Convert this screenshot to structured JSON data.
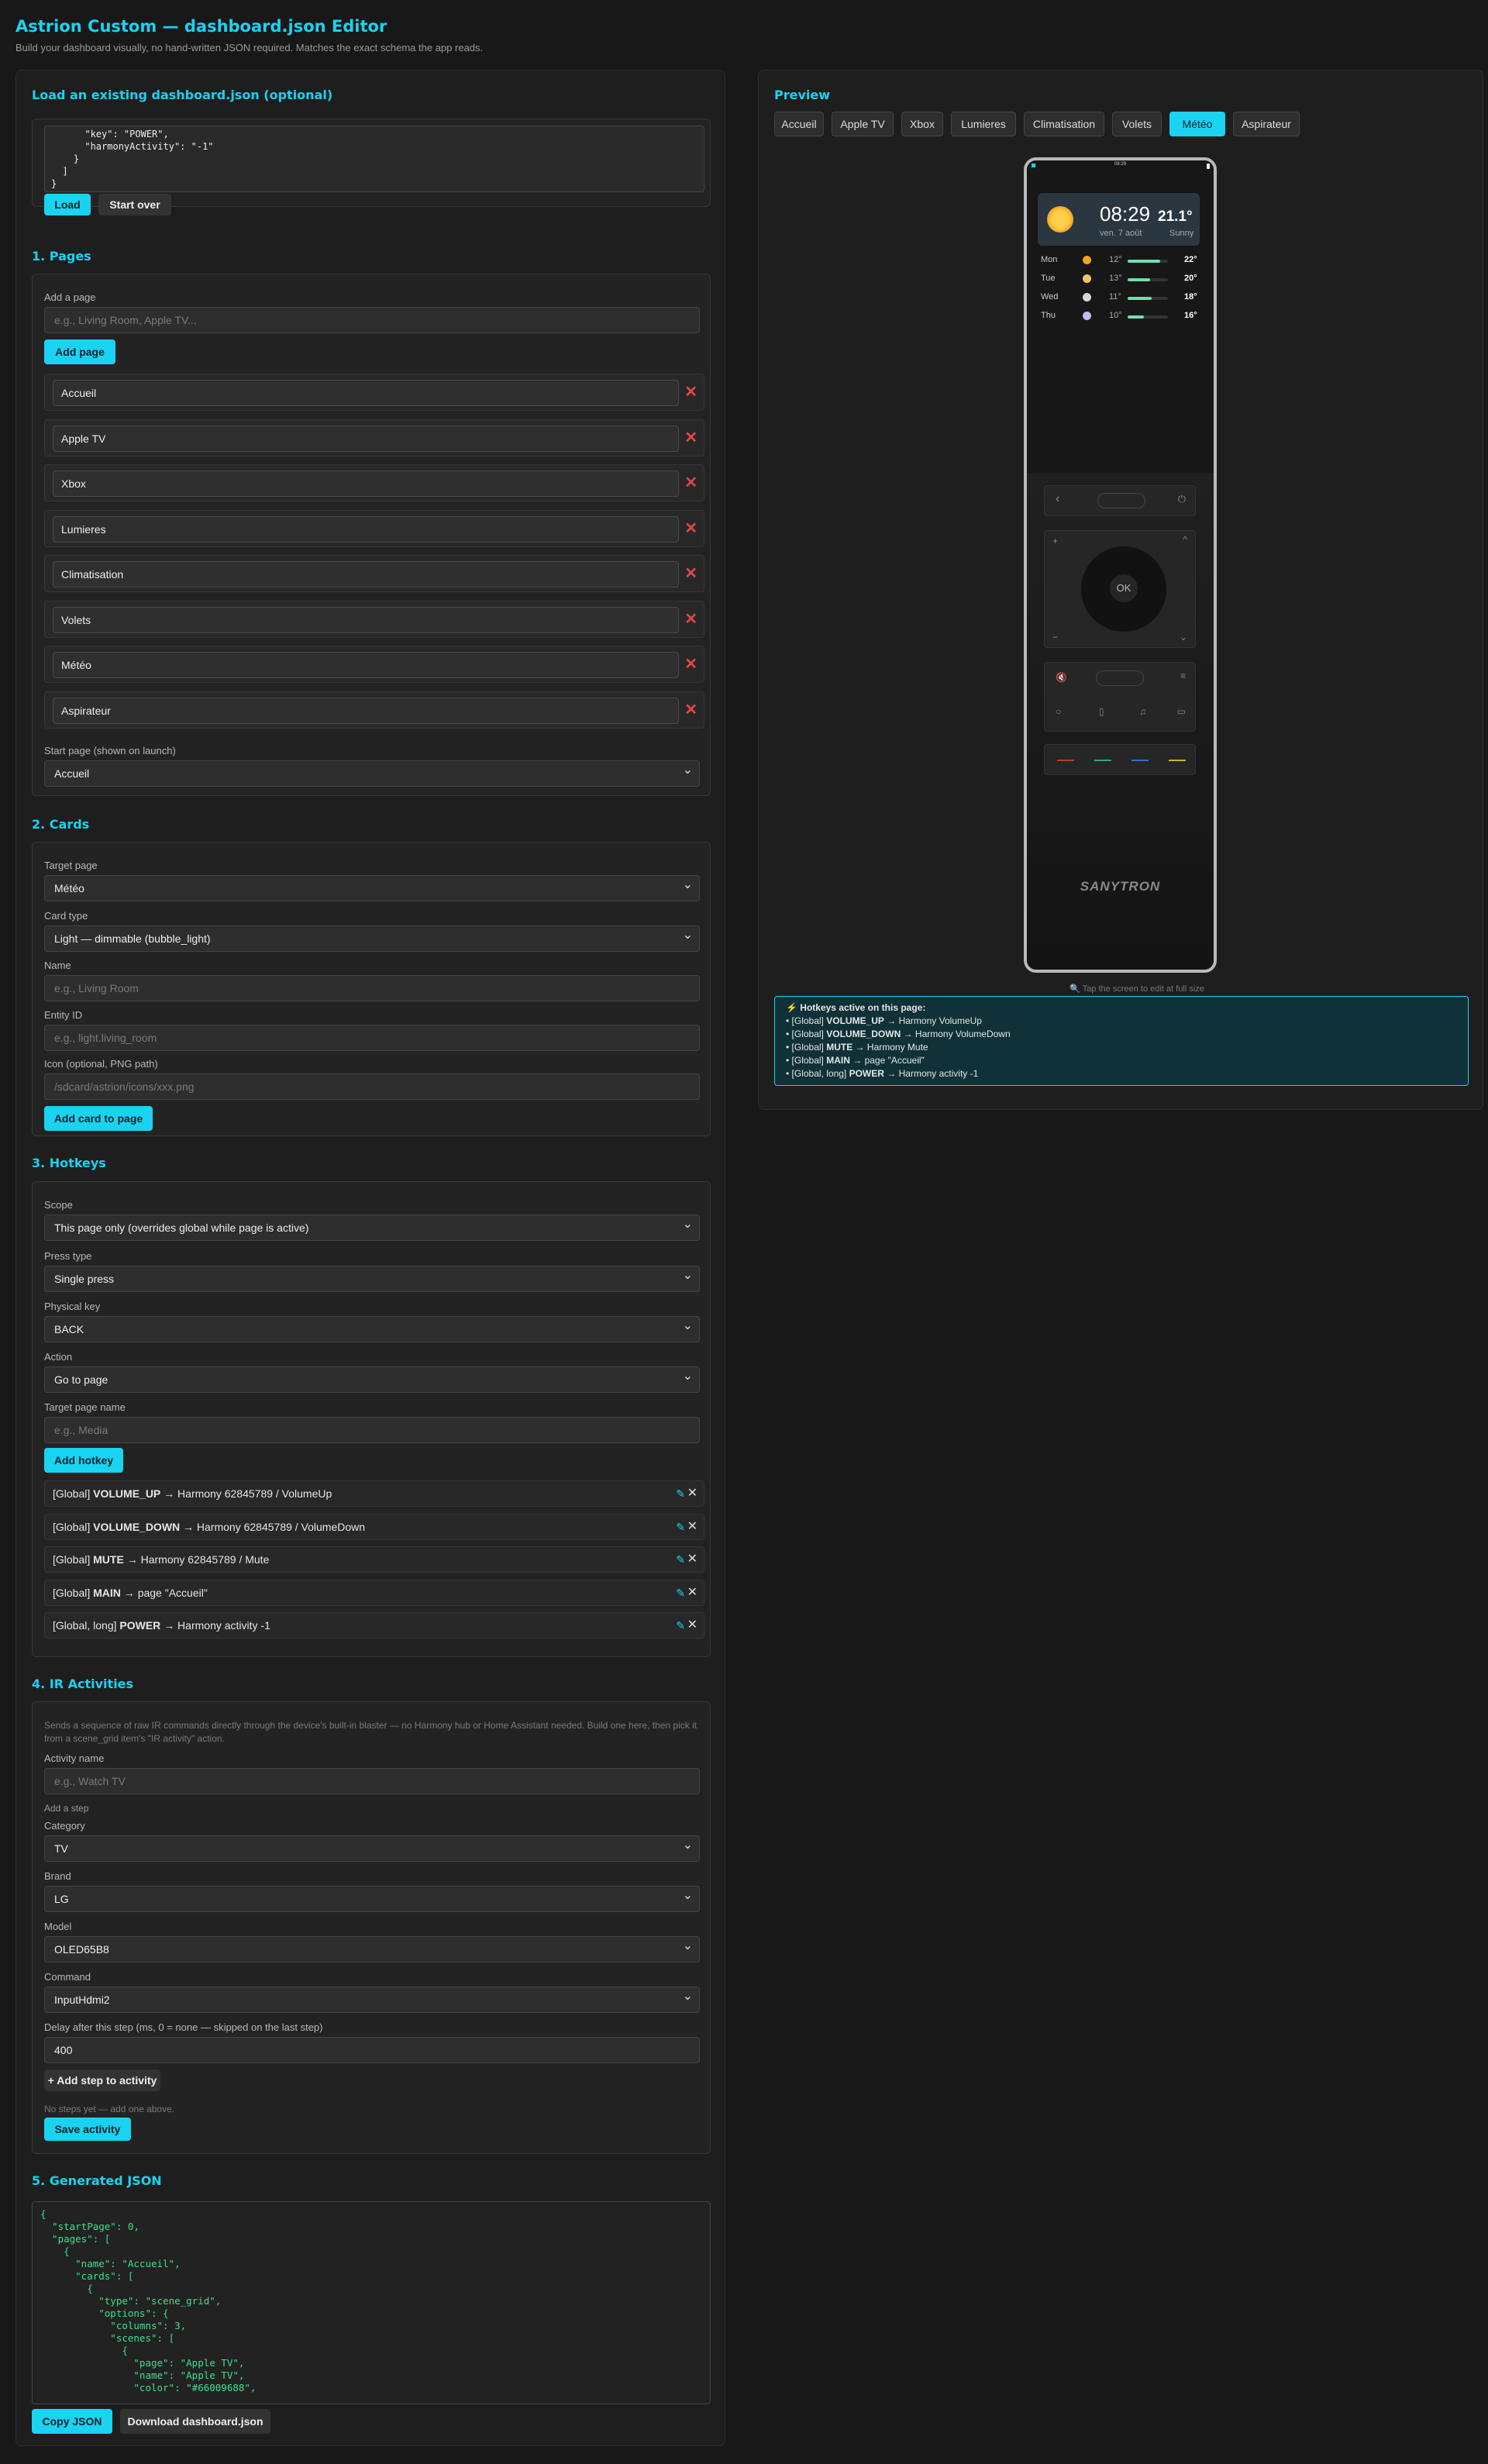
{
  "header": {
    "title": "Astrion Custom — dashboard.json Editor",
    "subtitle": "Build your dashboard visually, no hand-written JSON required. Matches the exact schema the app reads."
  },
  "load": {
    "title": "Load an existing dashboard.json (optional)",
    "textarea": "      \"key\": \"POWER\",\n      \"harmonyActivity\": \"-1\"\n    }\n  ]\n}",
    "load_btn": "Load",
    "startover_btn": "Start over"
  },
  "pages": {
    "title": "1. Pages",
    "add_label": "Add a page",
    "add_placeholder": "e.g., Living Room, Apple TV...",
    "add_btn": "Add page",
    "items": [
      "Accueil",
      "Apple TV",
      "Xbox",
      "Lumieres",
      "Climatisation",
      "Volets",
      "Météo",
      "Aspirateur"
    ],
    "start_label": "Start page (shown on launch)",
    "start_value": "Accueil"
  },
  "cards": {
    "title": "2. Cards",
    "target_label": "Target page",
    "target_value": "Météo",
    "type_label": "Card type",
    "type_value": "Light — dimmable (bubble_light)",
    "name_label": "Name",
    "name_placeholder": "e.g., Living Room",
    "entity_label": "Entity ID",
    "entity_placeholder": "e.g., light.living_room",
    "icon_label": "Icon (optional, PNG path)",
    "icon_placeholder": "/sdcard/astrion/icons/xxx.png",
    "add_btn": "Add card to page"
  },
  "hotkeys": {
    "title": "3. Hotkeys",
    "scope_label": "Scope",
    "scope_value": "This page only (overrides global while page is active)",
    "press_label": "Press type",
    "press_value": "Single press",
    "key_label": "Physical key",
    "key_value": "BACK",
    "action_label": "Action",
    "action_value": "Go to page",
    "target_label": "Target page name",
    "target_placeholder": "e.g., Media",
    "add_btn": "Add hotkey",
    "items": [
      {
        "pre": "[Global] ",
        "key": "VOLUME_UP",
        "post": " → Harmony 62845789 / VolumeUp"
      },
      {
        "pre": "[Global] ",
        "key": "VOLUME_DOWN",
        "post": " → Harmony 62845789 / VolumeDown"
      },
      {
        "pre": "[Global] ",
        "key": "MUTE",
        "post": " → Harmony 62845789 / Mute"
      },
      {
        "pre": "[Global] ",
        "key": "MAIN",
        "post": " → page \"Accueil\""
      },
      {
        "pre": "[Global, long] ",
        "key": "POWER",
        "post": " → Harmony activity -1"
      }
    ]
  },
  "ir": {
    "title": "4. IR Activities",
    "desc": "Sends a sequence of raw IR commands directly through the device's built-in blaster — no Harmony hub or Home Assistant needed. Build one here, then pick it from a scene_grid item's \"IR activity\" action.",
    "name_label": "Activity name",
    "name_placeholder": "e.g., Watch TV",
    "step_label": "Add a step",
    "cat_label": "Category",
    "cat_value": "TV",
    "brand_label": "Brand",
    "brand_value": "LG",
    "model_label": "Model",
    "model_value": "OLED65B8",
    "cmd_label": "Command",
    "cmd_value": "InputHdmi2",
    "delay_label": "Delay after this step (ms, 0 = none — skipped on the last step)",
    "delay_value": "400",
    "addstep_btn": "+ Add step to activity",
    "nosteps": "No steps yet — add one above.",
    "save_btn": "Save activity"
  },
  "gen": {
    "title": "5. Generated JSON",
    "json": "{\n  \"startPage\": 0,\n  \"pages\": [\n    {\n      \"name\": \"Accueil\",\n      \"cards\": [\n        {\n          \"type\": \"scene_grid\",\n          \"options\": {\n            \"columns\": 3,\n            \"scenes\": [\n              {\n                \"page\": \"Apple TV\",\n                \"name\": \"Apple TV\",\n                \"color\": \"#66009688\",",
    "copy_btn": "Copy JSON",
    "download_btn": "Download dashboard.json"
  },
  "preview": {
    "title": "Preview",
    "tabs": [
      "Accueil",
      "Apple TV",
      "Xbox",
      "Lumieres",
      "Climatisation",
      "Volets",
      "Météo",
      "Aspirateur"
    ],
    "active_tab": "Météo",
    "status_time": "08:29",
    "time": "08:29",
    "date": "ven. 7 août",
    "temp": "21.1°",
    "cond": "Sunny",
    "forecast": [
      {
        "day": "Mon",
        "lo": "12°",
        "hi": "22°",
        "level": 0.8
      },
      {
        "day": "Tue",
        "lo": "13°",
        "hi": "20°",
        "level": 0.55
      },
      {
        "day": "Wed",
        "lo": "11°",
        "hi": "18°",
        "level": 0.6
      },
      {
        "day": "Thu",
        "lo": "10°",
        "hi": "16°",
        "level": 0.4
      }
    ],
    "ok": "OK",
    "brand": "SANYTRON",
    "hint": "🔍 Tap the screen to edit at full size",
    "hot_title": "Hotkeys active on this page:",
    "hot_items": [
      {
        "pre": "• [Global] ",
        "key": "VOLUME_UP",
        "post": " → Harmony VolumeUp"
      },
      {
        "pre": "• [Global] ",
        "key": "VOLUME_DOWN",
        "post": " → Harmony VolumeDown"
      },
      {
        "pre": "• [Global] ",
        "key": "MUTE",
        "post": " → Harmony Mute"
      },
      {
        "pre": "• [Global] ",
        "key": "MAIN",
        "post": " → page \"Accueil\""
      },
      {
        "pre": "• [Global, long] ",
        "key": "POWER",
        "post": " → Harmony activity -1"
      }
    ]
  },
  "colors": {
    "accent": "#19d3f0",
    "danger": "#e04848",
    "json_text": "#3de08a"
  }
}
